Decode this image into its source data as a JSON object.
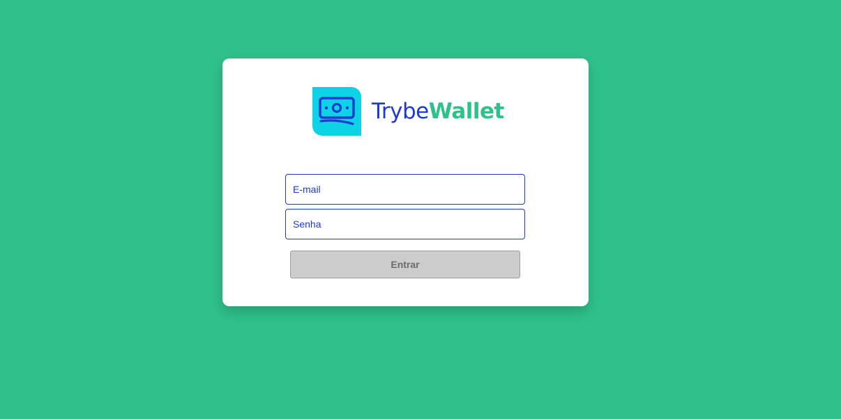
{
  "brand": {
    "name_part1": "Trybe",
    "name_part2": "Wallet",
    "icon": "money-bill-icon"
  },
  "login": {
    "email_placeholder": "E-mail",
    "email_value": "",
    "password_placeholder": "Senha",
    "password_value": "",
    "submit_label": "Entrar",
    "submit_disabled": true
  },
  "colors": {
    "background": "#2fc18c",
    "brand_blue": "#1d3ad3",
    "brand_green": "#2fc18c",
    "icon_background": "#0ed3e6",
    "button_disabled": "#cccccc"
  }
}
